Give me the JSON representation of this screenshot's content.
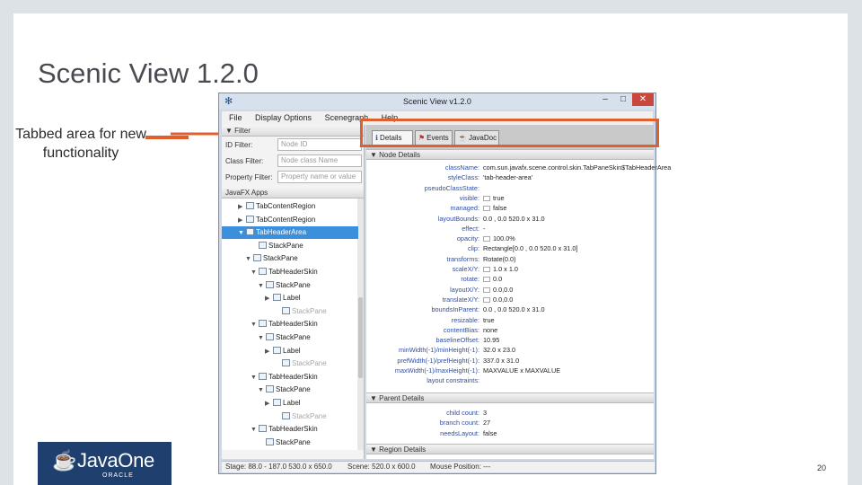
{
  "slide": {
    "title": "Scenic View 1.2.0",
    "annotation": "Tabbed area for new functionality",
    "logo_text": "JavaOne",
    "logo_sub": "ORACLE",
    "page_number": "20",
    "accent_color": "#e05f2c"
  },
  "window": {
    "title": "Scenic View v1.2.0",
    "menu": [
      "File",
      "Display Options",
      "Scenegraph",
      "Help"
    ],
    "filters": {
      "header": "Filter",
      "rows": [
        {
          "label": "ID Filter:",
          "placeholder": "Node ID"
        },
        {
          "label": "Class Filter:",
          "placeholder": "Node class Name"
        },
        {
          "label": "Property Filter:",
          "placeholder": "Property name or value"
        }
      ]
    },
    "tree_header": "JavaFX Apps",
    "tree": [
      {
        "label": "TabContentRegion",
        "toggle": "▶",
        "state": "normal"
      },
      {
        "label": "TabContentRegion",
        "toggle": "▶",
        "state": "normal"
      },
      {
        "label": "TabHeaderArea",
        "toggle": "▼",
        "state": "selected"
      },
      {
        "label": "StackPane",
        "toggle": "",
        "state": "normal"
      },
      {
        "label": "StackPane",
        "toggle": "▼",
        "state": "normal"
      },
      {
        "label": "TabHeaderSkin",
        "toggle": "▼",
        "state": "normal"
      },
      {
        "label": "StackPane",
        "toggle": "▼",
        "state": "normal"
      },
      {
        "label": "Label",
        "toggle": "▶",
        "state": "normal"
      },
      {
        "label": "StackPane",
        "toggle": "",
        "state": "dim"
      },
      {
        "label": "TabHeaderSkin",
        "toggle": "▼",
        "state": "normal"
      },
      {
        "label": "StackPane",
        "toggle": "▼",
        "state": "normal"
      },
      {
        "label": "Label",
        "toggle": "▶",
        "state": "normal"
      },
      {
        "label": "StackPane",
        "toggle": "",
        "state": "dim"
      },
      {
        "label": "TabHeaderSkin",
        "toggle": "▼",
        "state": "normal"
      },
      {
        "label": "StackPane",
        "toggle": "▼",
        "state": "normal"
      },
      {
        "label": "Label",
        "toggle": "▶",
        "state": "normal"
      },
      {
        "label": "StackPane",
        "toggle": "",
        "state": "dim"
      },
      {
        "label": "TabHeaderSkin",
        "toggle": "▼",
        "state": "normal"
      },
      {
        "label": "StackPane",
        "toggle": "",
        "state": "normal"
      }
    ],
    "tabs": [
      "Details",
      "Events",
      "JavaDoc"
    ],
    "node_details_header": "Node Details",
    "node_details": [
      {
        "key": "className:",
        "value": "com.sun.javafx.scene.control.skin.TabPaneSkin$TabHeaderArea",
        "cb": false
      },
      {
        "key": "styleClass:",
        "value": "'tab-header-area'",
        "cb": false
      },
      {
        "key": "pseudoClassState:",
        "value": "",
        "cb": false
      },
      {
        "key": "visible:",
        "value": "true",
        "cb": true
      },
      {
        "key": "managed:",
        "value": "false",
        "cb": true
      },
      {
        "key": "layoutBounds:",
        "value": "0.0 , 0.0 520.0 x 31.0",
        "cb": false
      },
      {
        "key": "effect:",
        "value": "-",
        "cb": false
      },
      {
        "key": "opacity:",
        "value": "100.0%",
        "cb": true
      },
      {
        "key": "clip:",
        "value": "Rectangle[0.0 , 0.0 520.0 x 31.0]",
        "cb": false
      },
      {
        "key": "transforms:",
        "value": "Rotate(0.0)",
        "cb": false
      },
      {
        "key": "scaleX/Y:",
        "value": "1.0 x 1.0",
        "cb": true
      },
      {
        "key": "rotate:",
        "value": "0.0",
        "cb": true
      },
      {
        "key": "layoutX/Y:",
        "value": "0.0,0.0",
        "cb": true
      },
      {
        "key": "translateX/Y:",
        "value": "0.0,0.0",
        "cb": true
      },
      {
        "key": "boundsInParent:",
        "value": "0.0 , 0.0 520.0 x 31.0",
        "cb": false
      },
      {
        "key": "resizable:",
        "value": "true",
        "cb": false
      },
      {
        "key": "contentBias:",
        "value": "none",
        "cb": false
      },
      {
        "key": "baselineOffset:",
        "value": "10.95",
        "cb": false
      },
      {
        "key": "minWidth(-1)/minHeight(-1):",
        "value": "32.0 x 23.0",
        "cb": false
      },
      {
        "key": "prefWidth(-1)/prefHeight(-1):",
        "value": "337.0 x 31.0",
        "cb": false
      },
      {
        "key": "maxWidth(-1)/maxHeight(-1):",
        "value": "MAXVALUE x MAXVALUE",
        "cb": false
      },
      {
        "key": "layout constraints:",
        "value": "",
        "cb": false
      }
    ],
    "parent_details_header": "Parent Details",
    "parent_details": [
      {
        "key": "child count:",
        "value": "3"
      },
      {
        "key": "branch count:",
        "value": "27"
      },
      {
        "key": "needsLayout:",
        "value": "false"
      }
    ],
    "region_details_header": "Region Details",
    "status": {
      "stage": "Stage: 88.0 - 187.0 530.0 x 650.0",
      "scene": "Scene: 520.0 x 600.0",
      "mouse": "Mouse Position: ---"
    }
  }
}
